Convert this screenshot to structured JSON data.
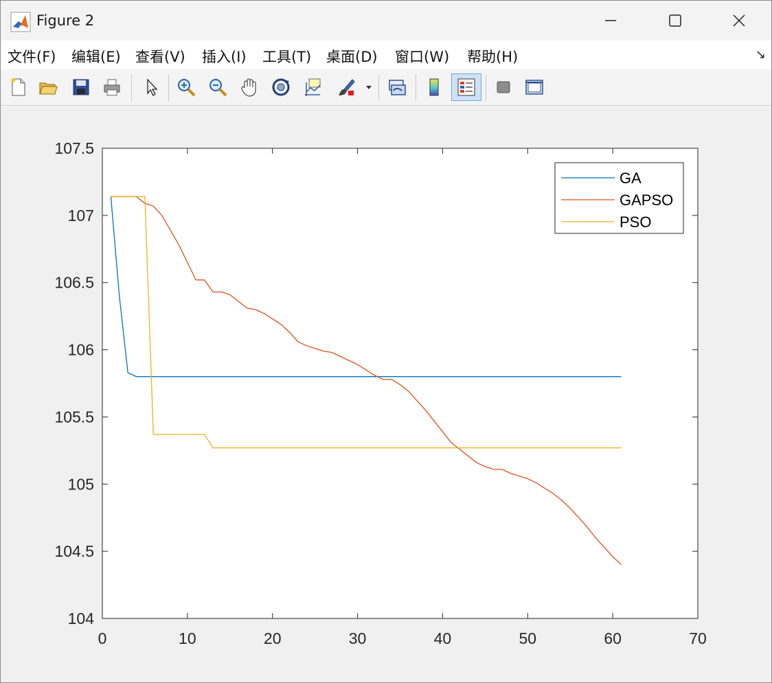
{
  "window": {
    "title": "Figure 2",
    "buttons": {
      "minimize": "minimize",
      "maximize": "maximize",
      "close": "close"
    }
  },
  "menubar": {
    "items": [
      "文件(F)",
      "编辑(E)",
      "查看(V)",
      "插入(I)",
      "工具(T)",
      "桌面(D)",
      "窗口(W)",
      "帮助(H)"
    ],
    "more_arrow": "↘"
  },
  "toolbar": {
    "icons": [
      "new-figure-icon",
      "open-file-icon",
      "save-icon",
      "print-icon",
      "pointer-icon",
      "zoom-in-icon",
      "zoom-out-icon",
      "pan-hand-icon",
      "rotate-3d-icon",
      "data-cursor-icon",
      "brush-icon",
      "link-plot-icon",
      "colorbar-icon",
      "legend-icon",
      "hide-plot-tools-icon",
      "show-plot-tools-icon"
    ],
    "active": "legend-icon"
  },
  "colors": {
    "GA": "#0072BD",
    "GAPSO": "#D95319",
    "PSO": "#EDB120"
  },
  "chart_data": {
    "type": "line",
    "title": "",
    "xlabel": "",
    "ylabel": "",
    "xlim": [
      0,
      70
    ],
    "ylim": [
      104,
      107.5
    ],
    "xticks": [
      0,
      10,
      20,
      30,
      40,
      50,
      60,
      70
    ],
    "yticks": [
      104,
      104.5,
      105,
      105.5,
      106,
      106.5,
      107,
      107.5
    ],
    "ytick_labels": [
      "104",
      "104.5",
      "105",
      "105.5",
      "106",
      "106.5",
      "107",
      "107.5"
    ],
    "grid": false,
    "legend_position": "top-right",
    "series": [
      {
        "name": "GA",
        "color": "#0072BD",
        "points": [
          [
            1,
            107.14
          ],
          [
            2,
            106.4
          ],
          [
            3,
            105.83
          ],
          [
            4,
            105.8
          ],
          [
            61,
            105.8
          ]
        ]
      },
      {
        "name": "GAPSO",
        "color": "#D95319",
        "points": [
          [
            1,
            107.14
          ],
          [
            4,
            107.14
          ],
          [
            5,
            107.09
          ],
          [
            6,
            107.07
          ],
          [
            7,
            107.0
          ],
          [
            8,
            106.89
          ],
          [
            9,
            106.78
          ],
          [
            10,
            106.65
          ],
          [
            11,
            106.52
          ],
          [
            12,
            106.52
          ],
          [
            13,
            106.43
          ],
          [
            14,
            106.43
          ],
          [
            15,
            106.41
          ],
          [
            16,
            106.36
          ],
          [
            17,
            106.31
          ],
          [
            18,
            106.3
          ],
          [
            19,
            106.27
          ],
          [
            20,
            106.23
          ],
          [
            21,
            106.19
          ],
          [
            22,
            106.13
          ],
          [
            23,
            106.06
          ],
          [
            24,
            106.03
          ],
          [
            25,
            106.01
          ],
          [
            26,
            105.99
          ],
          [
            27,
            105.98
          ],
          [
            28,
            105.95
          ],
          [
            29,
            105.92
          ],
          [
            30,
            105.89
          ],
          [
            31,
            105.85
          ],
          [
            32,
            105.81
          ],
          [
            33,
            105.78
          ],
          [
            34,
            105.78
          ],
          [
            35,
            105.74
          ],
          [
            36,
            105.69
          ],
          [
            37,
            105.62
          ],
          [
            38,
            105.55
          ],
          [
            39,
            105.47
          ],
          [
            40,
            105.39
          ],
          [
            41,
            105.31
          ],
          [
            42,
            105.26
          ],
          [
            43,
            105.21
          ],
          [
            44,
            105.16
          ],
          [
            45,
            105.13
          ],
          [
            46,
            105.11
          ],
          [
            47,
            105.11
          ],
          [
            48,
            105.08
          ],
          [
            49,
            105.06
          ],
          [
            50,
            105.04
          ],
          [
            51,
            105.01
          ],
          [
            52,
            104.97
          ],
          [
            53,
            104.93
          ],
          [
            54,
            104.88
          ],
          [
            55,
            104.82
          ],
          [
            56,
            104.75
          ],
          [
            57,
            104.68
          ],
          [
            58,
            104.6
          ],
          [
            59,
            104.53
          ],
          [
            60,
            104.46
          ],
          [
            61,
            104.4
          ]
        ]
      },
      {
        "name": "PSO",
        "color": "#EDB120",
        "points": [
          [
            1,
            107.14
          ],
          [
            5,
            107.14
          ],
          [
            6,
            105.37
          ],
          [
            12,
            105.37
          ],
          [
            13,
            105.27
          ],
          [
            61,
            105.27
          ]
        ]
      }
    ]
  }
}
